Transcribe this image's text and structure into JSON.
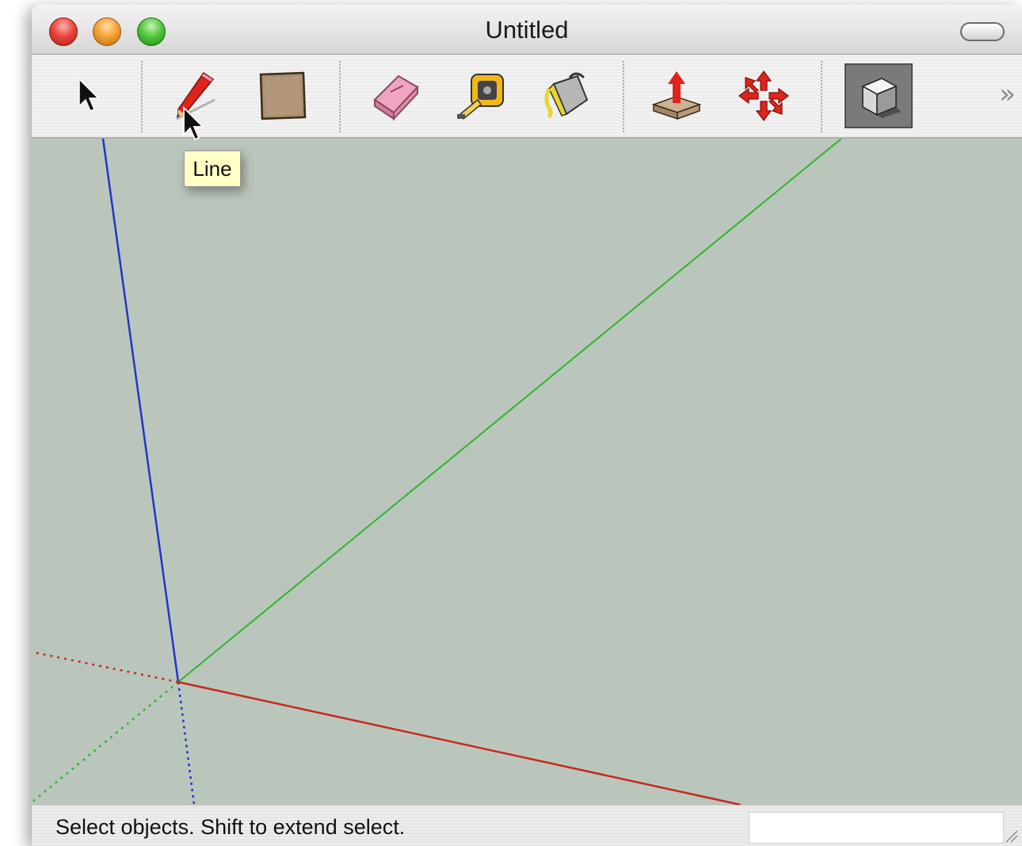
{
  "window": {
    "title": "Untitled"
  },
  "toolbar": {
    "tools": [
      {
        "name": "Select",
        "icon": "select-arrow-icon"
      },
      {
        "name": "Line",
        "icon": "pencil-icon"
      },
      {
        "name": "Rectangle",
        "icon": "rectangle-icon"
      },
      {
        "name": "Eraser",
        "icon": "eraser-icon"
      },
      {
        "name": "Tape Measure",
        "icon": "tape-measure-icon"
      },
      {
        "name": "Paint Bucket",
        "icon": "paint-bucket-icon"
      },
      {
        "name": "Push/Pull",
        "icon": "push-pull-icon"
      },
      {
        "name": "Move",
        "icon": "move-icon"
      },
      {
        "name": "Orbit",
        "icon": "orbit-cube-icon",
        "active": true
      }
    ],
    "overflow_label": "»"
  },
  "tooltip": {
    "text": "Line"
  },
  "viewport": {
    "background": "#bac6bb",
    "axis_colors": {
      "red": "#c8281e",
      "green": "#2fb52f",
      "blue": "#2235c8"
    }
  },
  "statusbar": {
    "message": "Select objects. Shift to extend select.",
    "measurements_value": ""
  }
}
